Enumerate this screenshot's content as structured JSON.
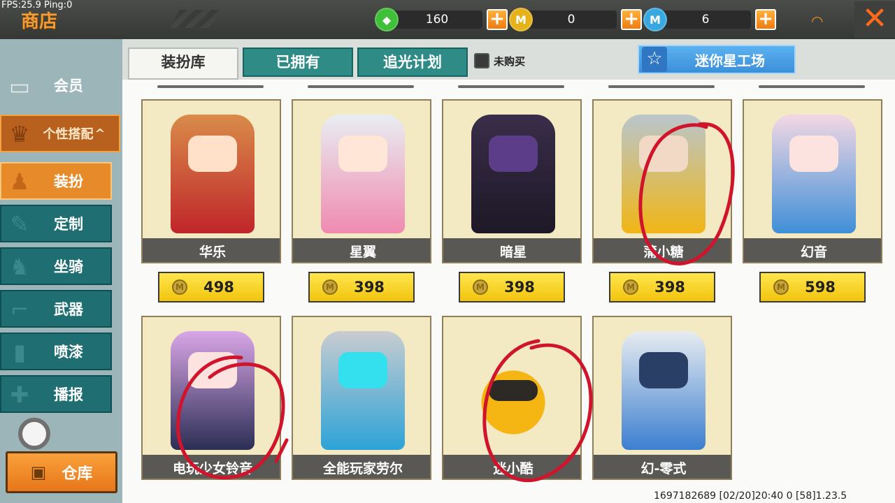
{
  "overlay": {
    "fps": "FPS:25.9  Ping:0",
    "build": "1697182689    [02/20]20:40 0  [58]1.23.5"
  },
  "header": {
    "title": "商店",
    "currencies": [
      {
        "icon": "green-gem-icon",
        "amount": "160",
        "color": "#3fbf3a"
      },
      {
        "icon": "gold-coin-icon",
        "amount": "0",
        "color": "#e5b21b"
      },
      {
        "icon": "mini-coin-icon",
        "amount": "6",
        "color": "#3aa8e0"
      }
    ],
    "plus_label": "+",
    "close_label": "✕",
    "signal_icon": "rss-signal-icon"
  },
  "sidebar": {
    "member": "会员",
    "category": "个性搭配",
    "category_arrow": "^",
    "items": [
      "装扮",
      "定制",
      "坐骑",
      "武器",
      "喷漆",
      "播报"
    ],
    "warehouse": "仓库"
  },
  "tabs": [
    "装扮库",
    "已拥有",
    "追光计划"
  ],
  "filter": {
    "label": "未购买",
    "checked": false
  },
  "workshop": {
    "label": "迷你星工场"
  },
  "accent_colors": {
    "orange": "#e78a2a",
    "teal": "#1f6e72",
    "price_yellow": "#f2c40e",
    "annotation_red": "#d0142c"
  },
  "items": [
    {
      "name": "华乐",
      "price": "498"
    },
    {
      "name": "星翼",
      "price": "398"
    },
    {
      "name": "暗星",
      "price": "398"
    },
    {
      "name": "蒲小糖",
      "price": "398"
    },
    {
      "name": "幻音",
      "price": "598"
    },
    {
      "name": "电玩少女铃音"
    },
    {
      "name": "全能玩家劳尔"
    },
    {
      "name": "迷小酷"
    },
    {
      "name": "幻-零式"
    }
  ]
}
